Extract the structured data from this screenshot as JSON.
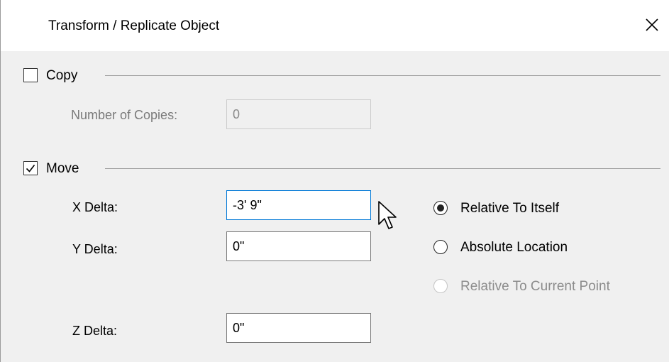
{
  "window": {
    "title": "Transform / Replicate Object"
  },
  "copy_group": {
    "label": "Copy",
    "checked": false,
    "number_of_copies_label": "Number of Copies:",
    "number_of_copies_value": "0"
  },
  "move_group": {
    "label": "Move",
    "checked": true,
    "x_delta_label": "X Delta:",
    "x_delta_value": "-3' 9\"",
    "y_delta_label": "Y Delta:",
    "y_delta_value": "0\"",
    "z_delta_label": "Z Delta:",
    "z_delta_value": "0\""
  },
  "position_mode": {
    "options": [
      {
        "label": "Relative To Itself",
        "selected": true,
        "enabled": true
      },
      {
        "label": "Absolute Location",
        "selected": false,
        "enabled": true
      },
      {
        "label": "Relative To Current Point",
        "selected": false,
        "enabled": false
      }
    ]
  },
  "icons": {
    "close": "close-icon",
    "checkmark": "checkmark-icon",
    "cursor": "mouse-pointer-icon"
  },
  "colors": {
    "focus_border": "#0078d7",
    "disabled_text": "#7a7a7a"
  }
}
